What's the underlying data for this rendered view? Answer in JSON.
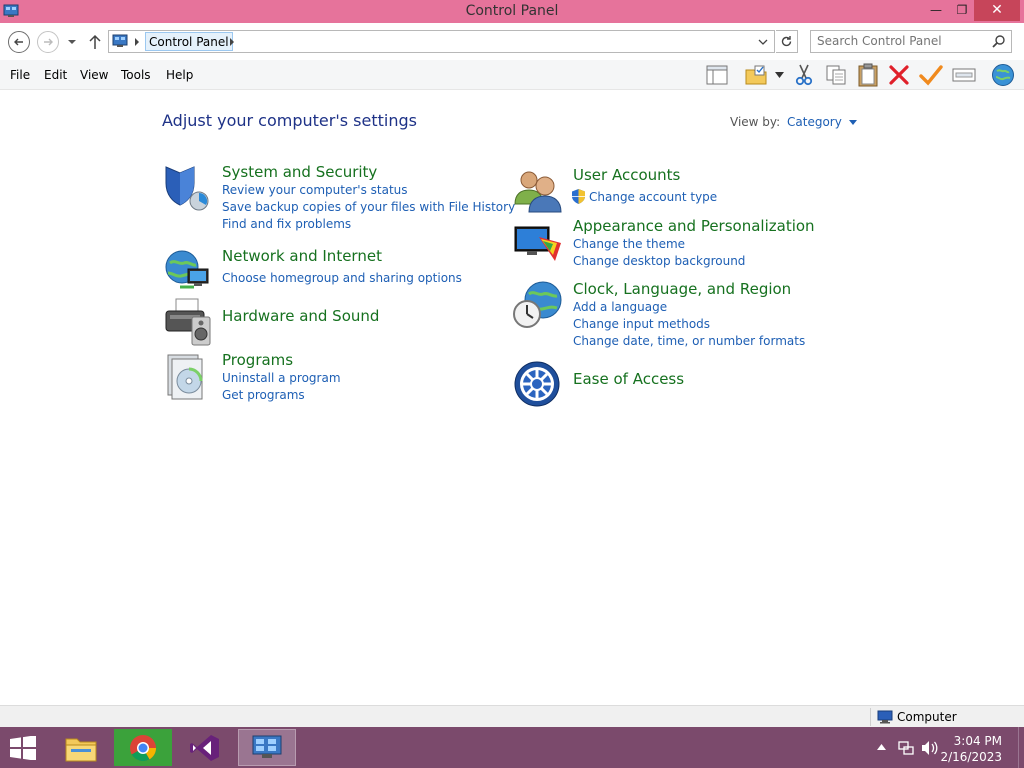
{
  "window": {
    "title": "Control Panel",
    "minimize_glyph": "—",
    "restore_glyph": "❐",
    "close_glyph": "✕"
  },
  "address": {
    "crumb": "Control Panel",
    "search_placeholder": "Search Control Panel"
  },
  "menu": [
    "File",
    "Edit",
    "View",
    "Tools",
    "Help"
  ],
  "toolbar_icons": [
    "layout-icon",
    "folder-options-icon",
    "cut-icon",
    "copy-icon",
    "paste-icon",
    "delete-icon",
    "check-icon",
    "properties-icon",
    "globe-icon"
  ],
  "main": {
    "heading": "Adjust your computer's settings",
    "view_by_label": "View by:",
    "view_by_value": "Category",
    "left": [
      {
        "title": "System and Security",
        "links": [
          "Review your computer's status",
          "Save backup copies of your files with File History",
          "Find and fix problems"
        ]
      },
      {
        "title": "Network and Internet",
        "links": [
          "Choose homegroup and sharing options"
        ]
      },
      {
        "title": "Hardware and Sound",
        "links": []
      },
      {
        "title": "Programs",
        "links": [
          "Uninstall a program",
          "Get programs"
        ]
      }
    ],
    "right": [
      {
        "title": "User Accounts",
        "links": [
          "Change account type"
        ]
      },
      {
        "title": "Appearance and Personalization",
        "links": [
          "Change the theme",
          "Change desktop background"
        ]
      },
      {
        "title": "Clock, Language, and Region",
        "links": [
          "Add a language",
          "Change input methods",
          "Change date, time, or number formats"
        ]
      },
      {
        "title": "Ease of Access",
        "links": []
      }
    ]
  },
  "statusbar": {
    "location": "Computer"
  },
  "taskbar": {
    "apps": [
      "file-explorer",
      "chrome",
      "visual-studio",
      "control-panel"
    ],
    "time": "3:04 PM",
    "date": "2/16/2023"
  },
  "colors": {
    "titlebar": "#e6739b",
    "close_button": "#c7455a",
    "category_title": "#16711f",
    "link": "#1e5fb4",
    "heading": "#1e3287",
    "taskbar": "#7b4a6c"
  }
}
